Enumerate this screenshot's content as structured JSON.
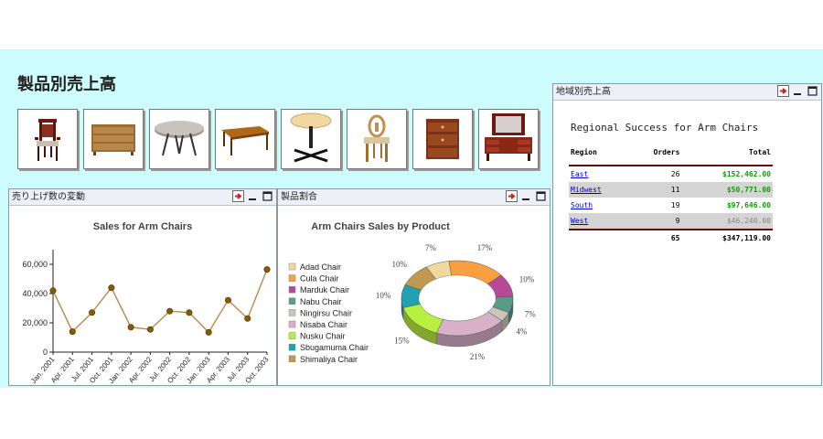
{
  "page": {
    "title": "製品別売上高"
  },
  "thumbnails": [
    {
      "name": "armchair-1"
    },
    {
      "name": "dresser"
    },
    {
      "name": "oval-table"
    },
    {
      "name": "coffee-table"
    },
    {
      "name": "round-table"
    },
    {
      "name": "armchair-2"
    },
    {
      "name": "nightstand"
    },
    {
      "name": "vanity"
    }
  ],
  "panels": {
    "line": {
      "title": "売り上げ数の変動"
    },
    "pie": {
      "title": "製品割合"
    },
    "region": {
      "title": "地域別売上高"
    }
  },
  "line_chart": {
    "type": "line",
    "title": "Sales for Arm Chairs",
    "categories": [
      "Jan. 2001",
      "Apr. 2001",
      "Jul. 2001",
      "Oct. 2001",
      "Jan. 2002",
      "Apr. 2002",
      "Jul. 2002",
      "Oct. 2002",
      "Jan. 2003",
      "Apr. 2003",
      "Jul. 2003",
      "Oct. 2003"
    ],
    "values": [
      42000,
      14000,
      27000,
      44000,
      17000,
      15500,
      28000,
      27000,
      13500,
      35500,
      23000,
      56500
    ],
    "yticks": [
      "0",
      "20,000",
      "40,000",
      "60,000"
    ],
    "ylim": [
      0,
      60000
    ],
    "color": "#b8884a",
    "marker_color": "#8a5a00"
  },
  "pie_chart": {
    "type": "pie",
    "title": "Arm Chairs Sales by Product",
    "legend": [
      "Adad Chair",
      "Cula Chair",
      "Marduk Chair",
      "Nabu Chair",
      "Ningirsu Chair",
      "Nisaba Chair",
      "Nusku Chair",
      "Sbugamuma Chair",
      "Shimaliya Chair"
    ],
    "colors": [
      "#f0d8a0",
      "#f8a040",
      "#b84898",
      "#5a9a88",
      "#c8c8b8",
      "#d8b0c8",
      "#b8f040",
      "#20a0b0",
      "#c09850"
    ],
    "slices": [
      {
        "color": "#f8a040",
        "pct": 17
      },
      {
        "color": "#b84898",
        "pct": 10
      },
      {
        "color": "#5a9a88",
        "pct": 7
      },
      {
        "color": "#c8c8b8",
        "pct": 4
      },
      {
        "color": "#d8b0c8",
        "pct": 21
      },
      {
        "color": "#b8f040",
        "pct": 15
      },
      {
        "color": "#20a0b0",
        "pct": 10
      },
      {
        "color": "#c09850",
        "pct": 10
      },
      {
        "color": "#f0d8a0",
        "pct": 7
      }
    ],
    "labels": [
      "17%",
      "10%",
      "7%",
      "4%",
      "21%",
      "15%",
      "10%",
      "10%",
      "7%"
    ]
  },
  "region_table": {
    "title": "Regional Success for Arm Chairs",
    "headers": [
      "Region",
      "Orders",
      "Total"
    ],
    "rows": [
      {
        "region": "East",
        "orders": "26",
        "total": "$152,462.00",
        "style": "green"
      },
      {
        "region": "Midwest",
        "orders": "11",
        "total": "$50,771.00",
        "style": "green"
      },
      {
        "region": "South",
        "orders": "19",
        "total": "$97,646.00",
        "style": "green"
      },
      {
        "region": "West",
        "orders": "9",
        "total": "$46,240.00",
        "style": "grey"
      }
    ],
    "footer": {
      "orders": "65",
      "total": "$347,119.00"
    }
  }
}
